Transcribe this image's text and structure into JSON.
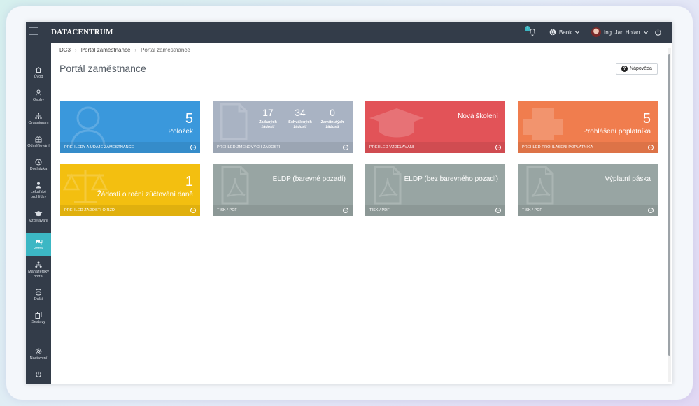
{
  "app": {
    "logo": "DATACENTRUM",
    "notifications_count": "1",
    "bank_label": "Bank",
    "user_name": "Ing. Jan Holan"
  },
  "sidebar": {
    "items": [
      {
        "label": "Úvod",
        "icon": "home-icon"
      },
      {
        "label": "Osoby",
        "icon": "people-icon"
      },
      {
        "label": "Organigram",
        "icon": "org-icon"
      },
      {
        "label": "Odměňování",
        "icon": "gift-icon"
      },
      {
        "label": "Docházka",
        "icon": "clock-icon"
      },
      {
        "label": "Lékařské prohlídky",
        "icon": "doctor-icon"
      },
      {
        "label": "Vzdělávání",
        "icon": "graduation-icon"
      },
      {
        "label": "Portál",
        "icon": "chat-icon"
      },
      {
        "label": "Manažerský portál",
        "icon": "hierarchy-icon"
      },
      {
        "label": "Další",
        "icon": "layers-icon"
      },
      {
        "label": "Sestavy",
        "icon": "docs-icon"
      },
      {
        "label": "Nastavení",
        "icon": "gear-icon"
      }
    ]
  },
  "breadcrumb": [
    "DC3",
    "Portál zaměstnance",
    "Portál zaměstnance"
  ],
  "page_title": "Portál zaměstnance",
  "help_label": "Nápověda",
  "tiles": {
    "employee": {
      "count": "5",
      "label": "Položek",
      "footer": "Přehledy a údaje zaměstnance",
      "color": "#3a98dc"
    },
    "changes": {
      "stats": [
        {
          "n": "17",
          "t1": "Zadaných",
          "t2": "žádostí"
        },
        {
          "n": "34",
          "t1": "Schválených",
          "t2": "žádostí"
        },
        {
          "n": "0",
          "t1": "Zamítnutých",
          "t2": "žádostí"
        }
      ],
      "footer": "Přehled změnových žádostí",
      "color": "#a9b3c3"
    },
    "training": {
      "label": "Nová školení",
      "footer": "Přehled vzdělávání",
      "color": "#e25358"
    },
    "declaration": {
      "count": "5",
      "label": "Prohlášení poplatníka",
      "footer": "Přehled prohlášení poplatníka",
      "color": "#f07d4e"
    },
    "annual": {
      "count": "1",
      "label": "Žádostí o roční zúčtování daně",
      "footer": "Přehled žádostí o RZD",
      "color": "#f3bf10"
    },
    "eldp_color": {
      "label": "ELDP (barevné pozadí)",
      "footer": "Tisk / PDF",
      "color": "#98a5a3"
    },
    "eldp_plain": {
      "label": "ELDP (bez barevného pozadí)",
      "footer": "Tisk / PDF",
      "color": "#98a5a3"
    },
    "payslip": {
      "label": "Výplatní páska",
      "footer": "Tisk / PDF",
      "color": "#98a5a3"
    }
  }
}
